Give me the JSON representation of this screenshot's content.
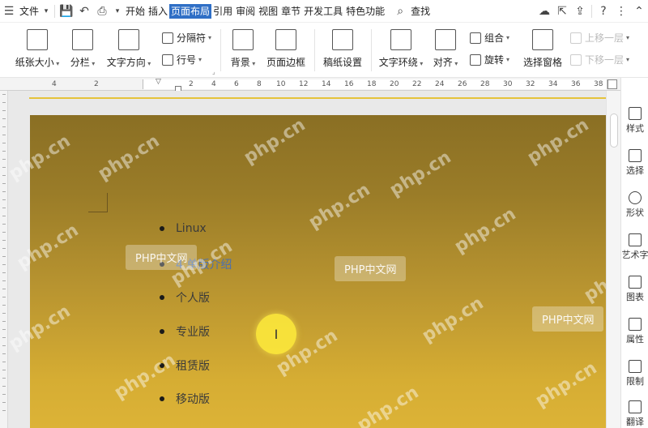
{
  "menubar": {
    "file_label": "文件",
    "tabs": [
      "开始",
      "插入",
      "页面布局",
      "引用",
      "审阅",
      "视图",
      "章节",
      "开发工具",
      "特色功能"
    ],
    "active_tab": "页面布局",
    "search_label": "查找"
  },
  "ribbon": {
    "paper_size": "纸张大小",
    "columns": "分栏",
    "text_direction": "文字方向",
    "separator": "分隔符",
    "line_number": "行号",
    "background": "背景",
    "page_border": "页面边框",
    "draft_paper": "稿纸设置",
    "text_wrap": "文字环绕",
    "align": "对齐",
    "group": "组合",
    "rotate": "旋转",
    "selection_pane": "选择窗格",
    "bring_forward": "上移一层",
    "send_backward": "下移一层"
  },
  "ruler": {
    "ticks": [
      "4",
      "2",
      "2",
      "4",
      "6",
      "8",
      "10",
      "12",
      "14",
      "16",
      "18",
      "20",
      "22",
      "24",
      "26",
      "28",
      "30",
      "32",
      "34",
      "36",
      "38"
    ]
  },
  "document": {
    "list_items": [
      {
        "text": "Linux"
      },
      {
        "text": "4 单版介绍"
      },
      {
        "text": "个人版"
      },
      {
        "text": "专业版"
      },
      {
        "text": "租赁版"
      },
      {
        "text": "移动版"
      }
    ],
    "cursor_glyph": "I",
    "watermark_text": "php.cn",
    "watermark_box_text": "PHP中文网"
  },
  "side_panel": {
    "items": [
      "样式",
      "选择",
      "形状",
      "艺术字",
      "图表",
      "属性",
      "限制",
      "翻译"
    ]
  },
  "colors": {
    "active_tab": "#2f6fc6",
    "page_top": "#8a6f24",
    "page_bottom": "#dcb337",
    "cursor_highlight": "#ffec3c"
  }
}
